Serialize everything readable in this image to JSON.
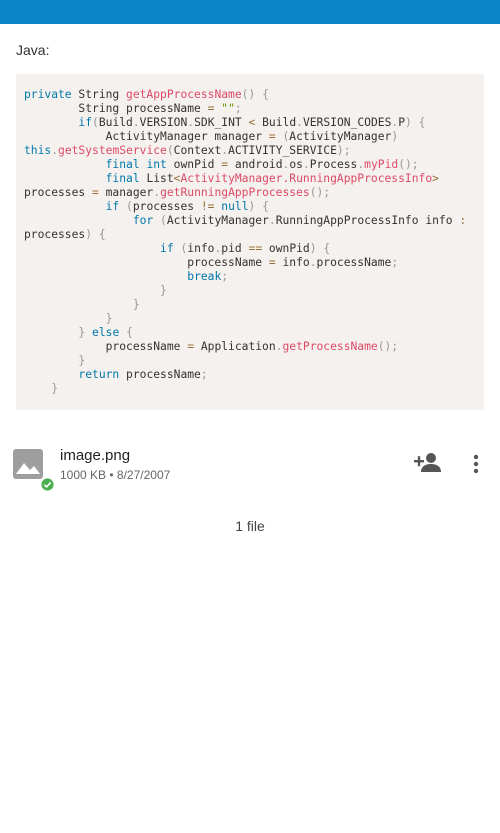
{
  "header": {
    "bar_color": "#0a84c6"
  },
  "snippet": {
    "language_label": "Java:",
    "background": "#f4f1ee"
  },
  "file": {
    "name": "image.png",
    "meta": "1000 KB • 8/27/2007",
    "thumb_icon": "image-icon",
    "status_icon": "check-circle-icon",
    "status_color": "#4caf50",
    "share_icon": "person-add-icon",
    "menu_icon": "more-vert-icon"
  },
  "footer": {
    "file_count": "1 file"
  }
}
